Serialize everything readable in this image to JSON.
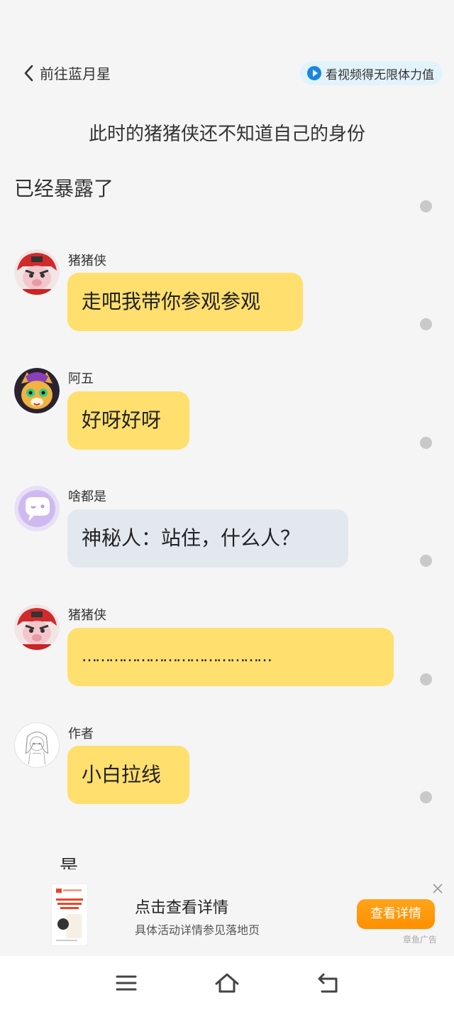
{
  "header": {
    "back_label": "前往蓝月星",
    "video_label": "看视频得无限体力值"
  },
  "narration": {
    "line1": "此时的猪猪侠还不知道自己的身份",
    "line2": "已经暴露了"
  },
  "messages": [
    {
      "name": "猪猪侠",
      "text": "走吧我带你参观参观",
      "avatar": "pig-hero-avatar"
    },
    {
      "name": "阿五",
      "text": "好呀好呀",
      "avatar": "awu-avatar"
    },
    {
      "name": "啥都是",
      "text": "神秘人：站住，什么人？",
      "avatar": "purple-chat-avatar"
    },
    {
      "name": "猪猪侠",
      "text": "……………………………………",
      "avatar": "pig-hero-avatar"
    },
    {
      "name": "作者",
      "text": "小白拉线",
      "avatar": "author-sketch-avatar"
    }
  ],
  "partial_text": "是",
  "ad": {
    "title": "点击查看详情",
    "subtitle": "具体活动详情参见落地页",
    "button": "查看详情",
    "label": "章鱼广告"
  },
  "colors": {
    "bubble_yellow": "#ffdf6e",
    "bubble_gray": "#e3e8ef",
    "ad_orange": "#ff9a0d",
    "pill_blue": "#1a86e0"
  }
}
